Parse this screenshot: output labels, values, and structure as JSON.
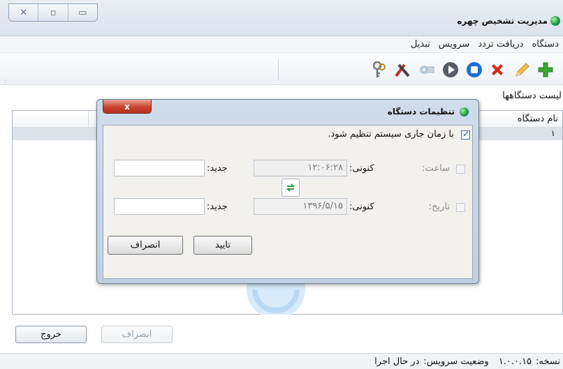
{
  "window": {
    "title": "مدیریت تشخیص چهره"
  },
  "menu": [
    "دستگاه",
    "دریافت تردد",
    "سرویس",
    "تبدیل"
  ],
  "toolbar": {
    "icons": [
      "add-icon",
      "edit-icon",
      "delete-icon",
      "stop-icon",
      "play-icon",
      "settings-icon",
      "tools-icon",
      "keys-icon"
    ]
  },
  "list": {
    "label": "لیست دستگاهها",
    "column_name": "نام دستگاه",
    "rows": [
      {
        "name": "۱"
      }
    ]
  },
  "buttons": {
    "exit": "خروج",
    "cancel": "انصراف"
  },
  "status": {
    "version_label": "نسخه:",
    "version_value": "۱.۰.۰.۱۵",
    "service_label": "وضعیت سرویس:",
    "service_value": "در حال اجرا"
  },
  "dialog": {
    "title": "تنظیمات دستگاه",
    "close_label": "x",
    "sync_checkbox_label": "با زمان جاری سیستم تنظیم شود.",
    "sync_checked": true,
    "time_label": "ساعت:",
    "date_label": "تاریخ:",
    "current_label": "کنونی:",
    "new_label": "جدید:",
    "current_time": "۱۲:۰۶:۲۸",
    "current_date": "۱۳۹۶/۵/۱۵",
    "new_time": "",
    "new_date": "",
    "confirm": "تایید",
    "cancel": "انصراف"
  },
  "colors": {
    "delete": "#d9281c",
    "add": "#3ba534",
    "play_stop": "#1e6fd0"
  }
}
